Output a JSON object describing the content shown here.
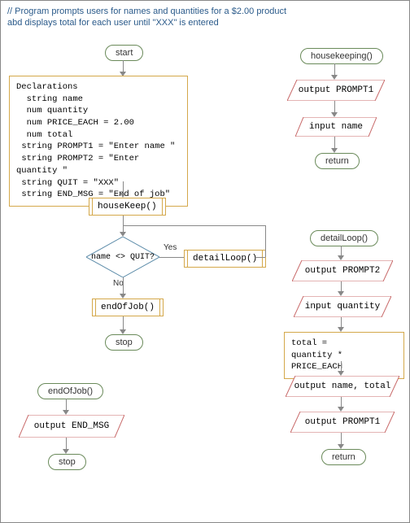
{
  "comment": {
    "line1": "// Program prompts users for names and quantities for a $2.00 product",
    "line2": "abd displays total for each user until \"XXX\" is entered"
  },
  "main": {
    "start": "start",
    "declarations_title": "Declarations",
    "decl_lines": {
      "l1": "string name",
      "l2": "num quantity",
      "l3": "num PRICE_EACH = 2.00",
      "l4": "num total",
      "l5": "string PROMPT1 = \"Enter name \"",
      "l6": "string PROMPT2 = \"Enter quantity \"",
      "l7": "string QUIT = \"XXX\"",
      "l8": "string END_MSG =  \"End of job\""
    },
    "housekeep_call": "houseKeep()",
    "decision": "name <> QUIT?",
    "yes": "Yes",
    "no": "No",
    "detailloop_call": "detailLoop()",
    "endofjob_call": "endOfJob()",
    "stop": "stop"
  },
  "housekeeping_sub": {
    "title": "housekeeping()",
    "out1": "output PROMPT1",
    "input": "input name",
    "return": "return"
  },
  "detailloop_sub": {
    "title": "detailLoop()",
    "out_prompt2": "output PROMPT2",
    "input_qty": "input quantity",
    "calc": "total =\nquantity * PRICE_EACH",
    "out_name_total": "output name, total",
    "out_prompt1": "output PROMPT1",
    "return": "return"
  },
  "endofjob_sub": {
    "title": "endOfJob()",
    "out_end": "output END_MSG",
    "stop": "stop"
  },
  "chart_data": {
    "type": "flowchart",
    "program_description": "Program prompts users for names and quantities for a $2.00 product and displays total for each user until \"XXX\" is entered",
    "main_flow": [
      {
        "shape": "terminal",
        "text": "start"
      },
      {
        "shape": "process",
        "text": "Declarations\n  string name\n  num quantity\n  num PRICE_EACH = 2.00\n  num total\n  string PROMPT1 = \"Enter name \"\n  string PROMPT2 = \"Enter quantity \"\n  string QUIT = \"XXX\"\n  string END_MSG = \"End of job\""
      },
      {
        "shape": "subroutine",
        "text": "houseKeep()"
      },
      {
        "shape": "decision",
        "text": "name <> QUIT?",
        "yes_to": "detailLoop()",
        "no_to": "endOfJob()",
        "loop_back_from_yes": true
      },
      {
        "shape": "subroutine",
        "text": "endOfJob()"
      },
      {
        "shape": "terminal",
        "text": "stop"
      }
    ],
    "subroutines": {
      "housekeeping()": [
        {
          "shape": "terminal",
          "text": "housekeeping()"
        },
        {
          "shape": "io",
          "text": "output PROMPT1"
        },
        {
          "shape": "io",
          "text": "input name"
        },
        {
          "shape": "terminal",
          "text": "return"
        }
      ],
      "detailLoop()": [
        {
          "shape": "terminal",
          "text": "detailLoop()"
        },
        {
          "shape": "io",
          "text": "output PROMPT2"
        },
        {
          "shape": "io",
          "text": "input quantity"
        },
        {
          "shape": "process",
          "text": "total = quantity * PRICE_EACH"
        },
        {
          "shape": "io",
          "text": "output name, total"
        },
        {
          "shape": "io",
          "text": "output PROMPT1"
        },
        {
          "shape": "terminal",
          "text": "return"
        }
      ],
      "endOfJob()": [
        {
          "shape": "terminal",
          "text": "endOfJob()"
        },
        {
          "shape": "io",
          "text": "output END_MSG"
        },
        {
          "shape": "terminal",
          "text": "stop"
        }
      ]
    }
  }
}
